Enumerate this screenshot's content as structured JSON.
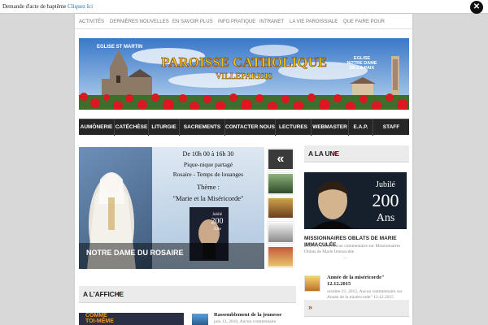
{
  "notice": {
    "text": "Demande d'acte de baptême",
    "link": "Cliquez Ici"
  },
  "topnav": [
    "ACTIVITÉS",
    "DERNIÈRES NOUVELLES",
    "EN SAVOIR PLUS",
    "INFO PRATIQUE",
    "INTRANET",
    "LA VIE PAROISSIALE",
    "QUE FAIRE POUR"
  ],
  "banner": {
    "title": "PAROISSE CATHOLIQUE",
    "subtitle": "VILLEPARISIS",
    "left_label": "EGLISE ST MARTIN",
    "right_label": [
      "EGLISE",
      "NOTRE DAME",
      "DE LA PAIX"
    ]
  },
  "mainnav": [
    "AUMÔNERIE",
    "CATÉCHÈSE",
    "LITURGIE",
    "SACREMENTS",
    "CONTACTER NOUS",
    "LECTURES",
    "WEBMASTER",
    "E.A.P.",
    "STAFF"
  ],
  "slider": {
    "line1": "De 10h 00 à 16h 30",
    "line2": "Pique-nique partagé",
    "line3": "Rosaire - Temps de louanges",
    "theme_label": "Thème :",
    "theme": "\"Marie et la Miséricorde\"",
    "book_top": "Jubilé",
    "book_num": "200",
    "book_ans": "Ans",
    "caption": "NOTRE DAME DU ROSAIRE"
  },
  "a_la_une": {
    "heading": "A LA UNE",
    "jubile": "Jubilé",
    "num": "200",
    "ans": "Ans",
    "article_title": "MISSIONNAIRES OBLATS DE MARIE IMMACULÉE",
    "meta": "avril 18, 2016, Aucun commentaire sur Missionnaires Oblats de Marie Immaculée",
    "more": "...",
    "item2_title": "Année de la miséricorde\" 12.12.2015",
    "item2_meta": "octobre 21, 2015, Aucun commentaire sur Année de la miséricorde\" 12.12.2015"
  },
  "a_laffiche": {
    "heading": "A L'AFFICHE",
    "item_title": "Rassemblement de la jeunesse",
    "item_meta": "juin 13, 2016, Aucun commentaire",
    "poster_text1": "COMME",
    "poster_text2": "TOI-MÊME"
  },
  "colors": {
    "accent": "#c0392b",
    "nav_bg": "#262626",
    "link": "#1e6ea8"
  }
}
